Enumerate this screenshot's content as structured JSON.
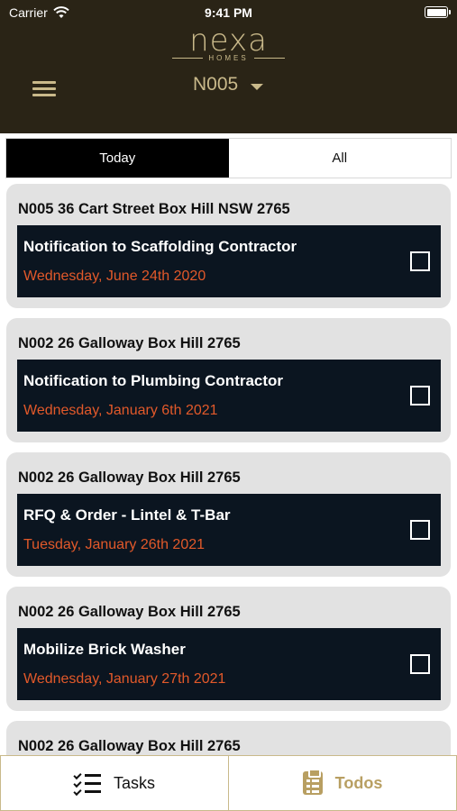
{
  "status_bar": {
    "carrier": "Carrier",
    "time": "9:41 PM"
  },
  "header": {
    "logo_word": "nexa",
    "logo_sub": "HOMES",
    "job_selected": "N005",
    "brand_color": "#c9b98a",
    "background_color": "#2a2416"
  },
  "tabs": {
    "today": "Today",
    "all": "All",
    "active": "Today"
  },
  "cards": [
    {
      "address": "N005 36 Cart Street Box Hill NSW 2765",
      "task_title": "Notification to Scaffolding Contractor",
      "task_date": "Wednesday, June 24th 2020",
      "checked": false
    },
    {
      "address": "N002 26 Galloway Box Hill 2765",
      "task_title": "Notification to Plumbing Contractor",
      "task_date": "Wednesday, January 6th 2021",
      "checked": false
    },
    {
      "address": "N002 26 Galloway Box Hill 2765",
      "task_title": "RFQ & Order - Lintel & T-Bar",
      "task_date": "Tuesday, January 26th 2021",
      "checked": false
    },
    {
      "address": "N002 26 Galloway Box Hill 2765",
      "task_title": "Mobilize Brick Washer",
      "task_date": "Wednesday, January 27th 2021",
      "checked": false
    },
    {
      "address": "N002 26 Galloway Box Hill 2765",
      "task_title": "",
      "task_date": "",
      "checked": false
    }
  ],
  "bottom_nav": {
    "tasks": {
      "label": "Tasks",
      "icon": "checklist-icon"
    },
    "todos": {
      "label": "Todos",
      "icon": "clipboard-icon"
    },
    "active": "Todos"
  },
  "colors": {
    "date_accent": "#e2592a",
    "task_bg": "#0b1520",
    "card_bg": "#e2e2e2"
  }
}
